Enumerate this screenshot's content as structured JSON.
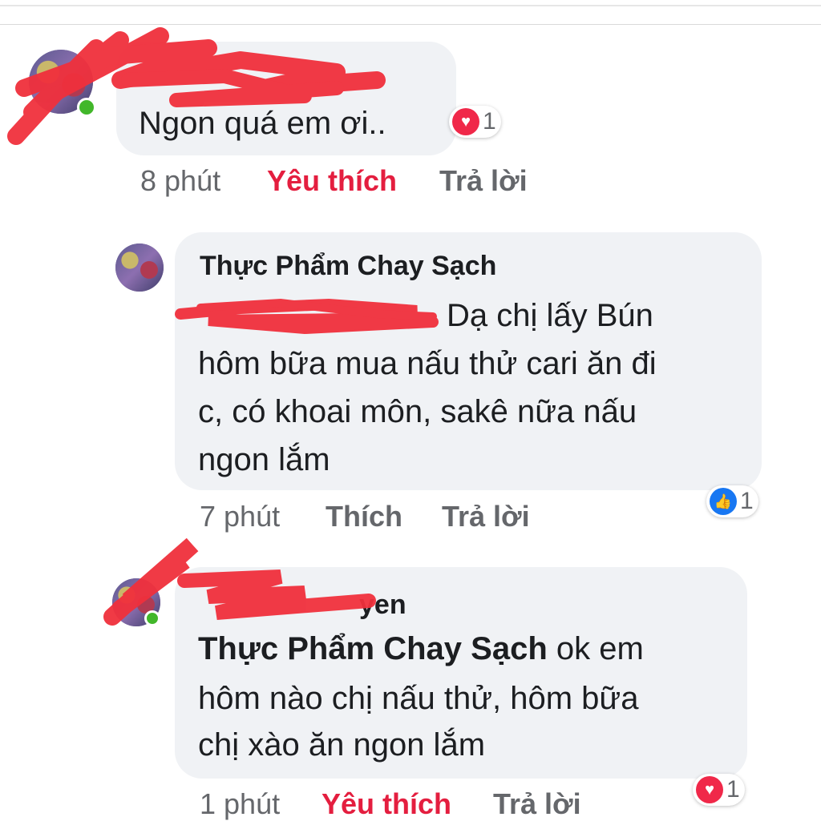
{
  "comments": [
    {
      "name": "",
      "text": "Ngon quá em ơi..",
      "time": "8 phút",
      "like_label": "Yêu thích",
      "reply_label": "Trả lời",
      "reaction": {
        "icon": "heart-icon",
        "count": "1",
        "color": "#f02849"
      }
    },
    {
      "name": "Thực Phẩm Chay Sạch",
      "text": "Dạ chị lấy Bún hôm bữa mua nấu thử cari ăn đi c, có khoai môn, sakê nữa nấu ngon lắm",
      "text_lines": [
        "Dạ chị lấy Bún",
        "hôm bữa mua nấu thử cari ăn đi",
        "c, có khoai môn, sakê nữa nấu",
        "ngon lắm"
      ],
      "time": "7 phút",
      "like_label": "Thích",
      "reply_label": "Trả lời",
      "reaction": {
        "icon": "thumbs-up-icon",
        "count": "1",
        "color": "#1877f2"
      }
    },
    {
      "name": "yen",
      "mention": "Thực Phẩm Chay Sạch",
      "text_lines": [
        " ok em",
        "hôm nào chị nấu thử, hôm bữa",
        "chị xào ăn ngon lắm"
      ],
      "time": "1 phút",
      "like_label": "Yêu thích",
      "reply_label": "Trả lời",
      "reaction": {
        "icon": "heart-icon",
        "count": "1",
        "color": "#f02849"
      }
    }
  ],
  "colors": {
    "bubble": "#f0f2f5",
    "loved": "#e41e3f",
    "muted": "#65676b",
    "online": "#42b72a",
    "redaction": "#f0303c"
  }
}
